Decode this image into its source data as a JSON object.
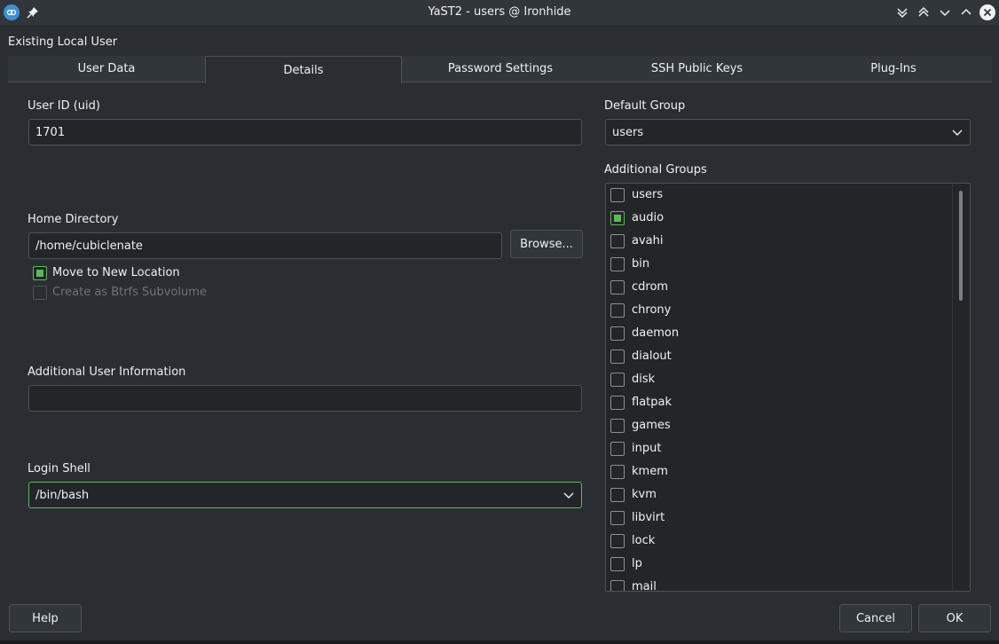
{
  "window": {
    "title": "YaST2 - users @ Ironhide"
  },
  "dialog": {
    "title": "Existing Local User"
  },
  "tabs": [
    {
      "label": "User Data"
    },
    {
      "label": "Details"
    },
    {
      "label": "Password Settings"
    },
    {
      "label": "SSH Public Keys"
    },
    {
      "label": "Plug-Ins"
    }
  ],
  "active_tab": "Details",
  "uid": {
    "label": "User ID (uid)",
    "value": "1701"
  },
  "home": {
    "label": "Home Directory",
    "value": "/home/cubiclenate",
    "browse_label": "Browse...",
    "move_label": "Move to New Location",
    "move_checked": true,
    "btrfs_label": "Create as Btrfs Subvolume",
    "btrfs_checked": false,
    "btrfs_enabled": false
  },
  "additional_info": {
    "label": "Additional User Information",
    "value": ""
  },
  "login_shell": {
    "label": "Login Shell",
    "value": "/bin/bash"
  },
  "default_group": {
    "label": "Default Group",
    "value": "users"
  },
  "additional_groups": {
    "label": "Additional Groups",
    "items": [
      {
        "name": "users",
        "checked": false
      },
      {
        "name": "audio",
        "checked": true
      },
      {
        "name": "avahi",
        "checked": false
      },
      {
        "name": "bin",
        "checked": false
      },
      {
        "name": "cdrom",
        "checked": false
      },
      {
        "name": "chrony",
        "checked": false
      },
      {
        "name": "daemon",
        "checked": false
      },
      {
        "name": "dialout",
        "checked": false
      },
      {
        "name": "disk",
        "checked": false
      },
      {
        "name": "flatpak",
        "checked": false
      },
      {
        "name": "games",
        "checked": false
      },
      {
        "name": "input",
        "checked": false
      },
      {
        "name": "kmem",
        "checked": false
      },
      {
        "name": "kvm",
        "checked": false
      },
      {
        "name": "libvirt",
        "checked": false
      },
      {
        "name": "lock",
        "checked": false
      },
      {
        "name": "lp",
        "checked": false
      },
      {
        "name": "mail",
        "checked": false
      }
    ]
  },
  "footer": {
    "help_label": "Help",
    "cancel_label": "Cancel",
    "ok_label": "OK"
  },
  "colors": {
    "accent": "#5cb85c",
    "background": "#2a2e32",
    "field": "#232629"
  }
}
